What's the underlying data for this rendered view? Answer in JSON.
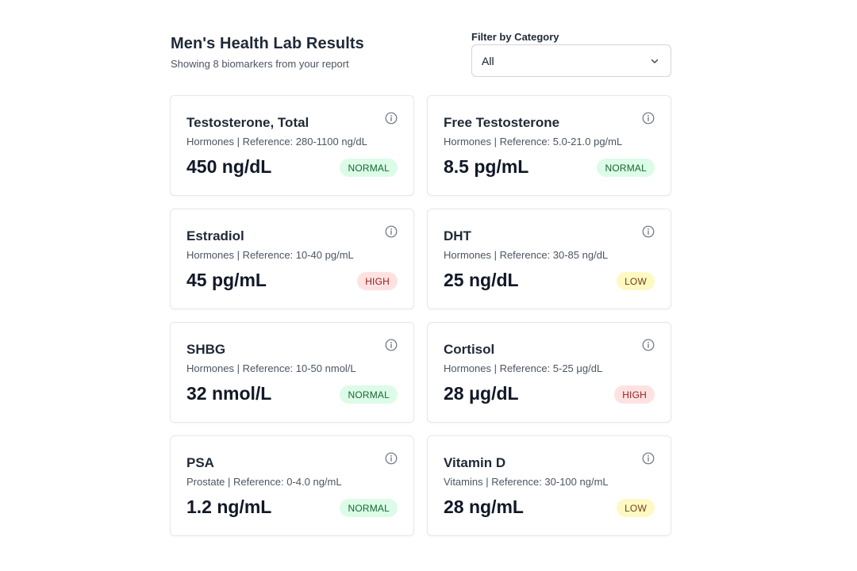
{
  "header": {
    "title": "Men's Health Lab Results",
    "subtitle": "Showing 8 biomarkers from your report"
  },
  "filter": {
    "label": "Filter by Category",
    "selected": "All",
    "icon": "chevron-down-icon"
  },
  "cards": [
    {
      "name": "Testosterone, Total",
      "meta": "Hormones | Reference: 280-1100 ng/dL",
      "value": "450 ng/dL",
      "status": "NORMAL",
      "status_key": "normal"
    },
    {
      "name": "Free Testosterone",
      "meta": "Hormones | Reference: 5.0-21.0 pg/mL",
      "value": "8.5 pg/mL",
      "status": "NORMAL",
      "status_key": "normal"
    },
    {
      "name": "Estradiol",
      "meta": "Hormones | Reference: 10-40 pg/mL",
      "value": "45 pg/mL",
      "status": "HIGH",
      "status_key": "high"
    },
    {
      "name": "DHT",
      "meta": "Hormones | Reference: 30-85 ng/dL",
      "value": "25 ng/dL",
      "status": "LOW",
      "status_key": "low"
    },
    {
      "name": "SHBG",
      "meta": "Hormones | Reference: 10-50 nmol/L",
      "value": "32 nmol/L",
      "status": "NORMAL",
      "status_key": "normal"
    },
    {
      "name": "Cortisol",
      "meta": "Hormones | Reference: 5-25 μg/dL",
      "value": "28 μg/dL",
      "status": "HIGH",
      "status_key": "high"
    },
    {
      "name": "PSA",
      "meta": "Prostate | Reference: 0-4.0 ng/mL",
      "value": "1.2 ng/mL",
      "status": "NORMAL",
      "status_key": "normal"
    },
    {
      "name": "Vitamin D",
      "meta": "Vitamins | Reference: 30-100 ng/mL",
      "value": "28 ng/mL",
      "status": "LOW",
      "status_key": "low"
    }
  ],
  "colors": {
    "normal_bg": "#dcfce7",
    "normal_fg": "#166534",
    "high_bg": "#fee2e2",
    "high_fg": "#991b1b",
    "low_bg": "#fef9c3",
    "low_fg": "#713f12"
  },
  "card_icon": "info-icon"
}
